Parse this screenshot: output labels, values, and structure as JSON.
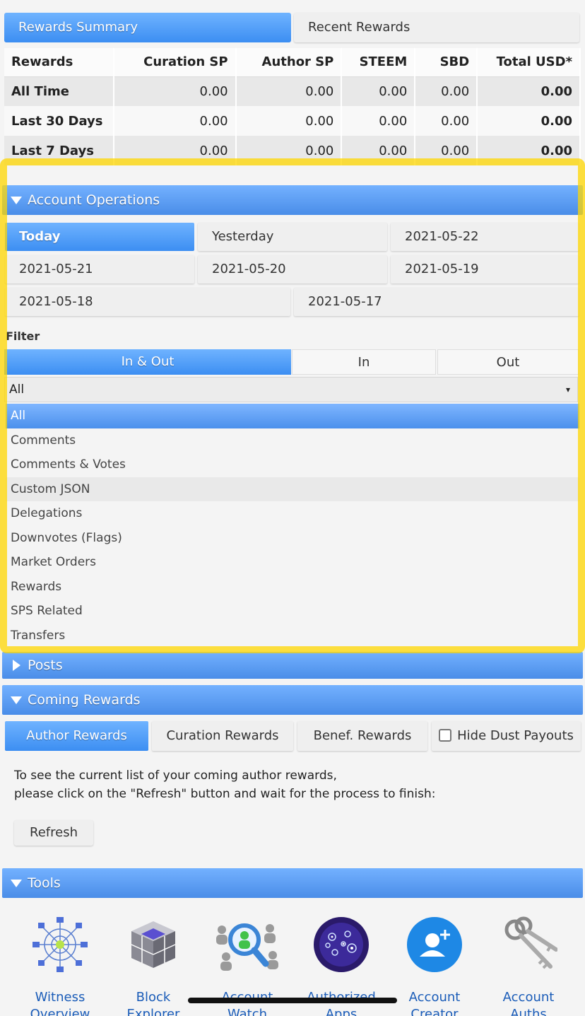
{
  "top_tabs": {
    "rewards_summary": "Rewards Summary",
    "recent_rewards": "Recent Rewards"
  },
  "rewards_table": {
    "headers": [
      "Rewards",
      "Curation SP",
      "Author SP",
      "STEEM",
      "SBD",
      "Total USD*"
    ],
    "rows": [
      {
        "label": "All Time",
        "curation": "0.00",
        "author": "0.00",
        "steem": "0.00",
        "sbd": "0.00",
        "total": "0.00"
      },
      {
        "label": "Last 30 Days",
        "curation": "0.00",
        "author": "0.00",
        "steem": "0.00",
        "sbd": "0.00",
        "total": "0.00"
      },
      {
        "label": "Last 7 Days",
        "curation": "0.00",
        "author": "0.00",
        "steem": "0.00",
        "sbd": "0.00",
        "total": "0.00"
      }
    ]
  },
  "account_operations": {
    "title": "Account Operations",
    "dates": [
      "Today",
      "Yesterday",
      "2021-05-22",
      "2021-05-21",
      "2021-05-20",
      "2021-05-19",
      "2021-05-18",
      "2021-05-17"
    ],
    "filter_label": "Filter",
    "direction": [
      "In & Out",
      "In",
      "Out"
    ],
    "select_value": "All",
    "select_arrow": "▾",
    "options": [
      "All",
      "Comments",
      "Comments & Votes",
      "Custom JSON",
      "Delegations",
      "Downvotes (Flags)",
      "Market Orders",
      "Rewards",
      "SPS Related",
      "Transfers"
    ]
  },
  "posts": {
    "title": "Posts"
  },
  "coming_rewards": {
    "title": "Coming Rewards",
    "tabs": [
      "Author Rewards",
      "Curation Rewards",
      "Benef. Rewards"
    ],
    "hide_dust": "Hide Dust Payouts",
    "line1": "To see the current list of your coming author rewards,",
    "line2": "please click on the \"Refresh\" button and wait for the process to finish:",
    "refresh": "Refresh"
  },
  "tools": {
    "title": "Tools",
    "items": [
      {
        "line1": "Witness",
        "line2": "Overview",
        "icon": "witness-network-icon"
      },
      {
        "line1": "Block",
        "line2": "Explorer",
        "icon": "block-cube-icon"
      },
      {
        "line1": "Account",
        "line2": "Watch",
        "icon": "magnifier-people-icon"
      },
      {
        "line1": "Authorized",
        "line2": "Apps",
        "icon": "sphere-icon"
      },
      {
        "line1": "Account",
        "line2": "Creator",
        "icon": "add-user-icon"
      },
      {
        "line1": "Account",
        "line2": "Auths",
        "icon": "keys-icon"
      }
    ]
  },
  "colors": {
    "accent_blue": "#4a8de8",
    "highlight_yellow": "#ffd700",
    "link_blue": "#1a5cb8"
  }
}
